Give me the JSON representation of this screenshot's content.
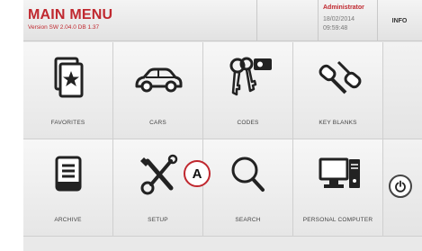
{
  "header": {
    "title": "MAIN MENU",
    "version": "Version SW 2.04.0 DB 1.37",
    "user": "Administrator",
    "date": "18/02/2014",
    "time": "09:59:48",
    "info_label": "INFO"
  },
  "tiles": [
    {
      "label": "FAVORITES",
      "icon": "favorites-star-card-icon"
    },
    {
      "label": "CARS",
      "icon": "car-icon"
    },
    {
      "label": "CODES",
      "icon": "keys-code-icon"
    },
    {
      "label": "KEY BLANKS",
      "icon": "key-blanks-icon"
    },
    {
      "label": "ARCHIVE",
      "icon": "archive-tray-icon"
    },
    {
      "label": "SETUP",
      "icon": "wrench-screwdriver-icon"
    },
    {
      "label": "SEARCH",
      "icon": "magnifier-icon"
    },
    {
      "label": "PERSONAL COMPUTER",
      "icon": "computer-icon"
    }
  ],
  "callout_label": "A",
  "colors": {
    "accent": "#c0282f",
    "icon": "#222222",
    "tile": "#eeeeee"
  }
}
